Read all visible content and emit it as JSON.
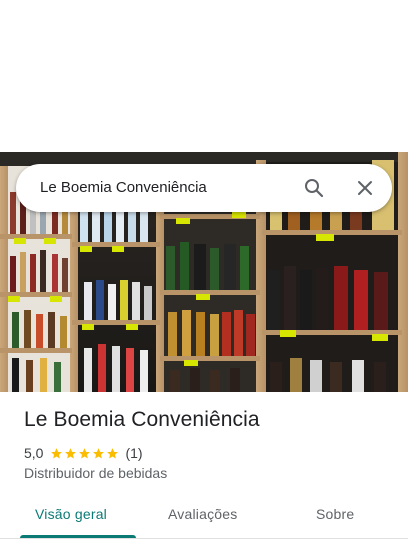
{
  "search": {
    "value": "Le Boemia Conveniência",
    "search_icon": "search-icon",
    "close_icon": "close-icon"
  },
  "place": {
    "name": "Le Boemia Conveniência",
    "rating": "5,0",
    "stars": 5,
    "review_count": "(1)",
    "category": "Distribuidor de bebidas"
  },
  "tabs": [
    {
      "label": "Visão geral",
      "active": true
    },
    {
      "label": "Avaliações",
      "active": false
    },
    {
      "label": "Sobre",
      "active": false
    }
  ],
  "colors": {
    "accent": "#0b7a75",
    "star": "#fbbc04",
    "text": "#202124",
    "secondary": "#5f6368"
  }
}
